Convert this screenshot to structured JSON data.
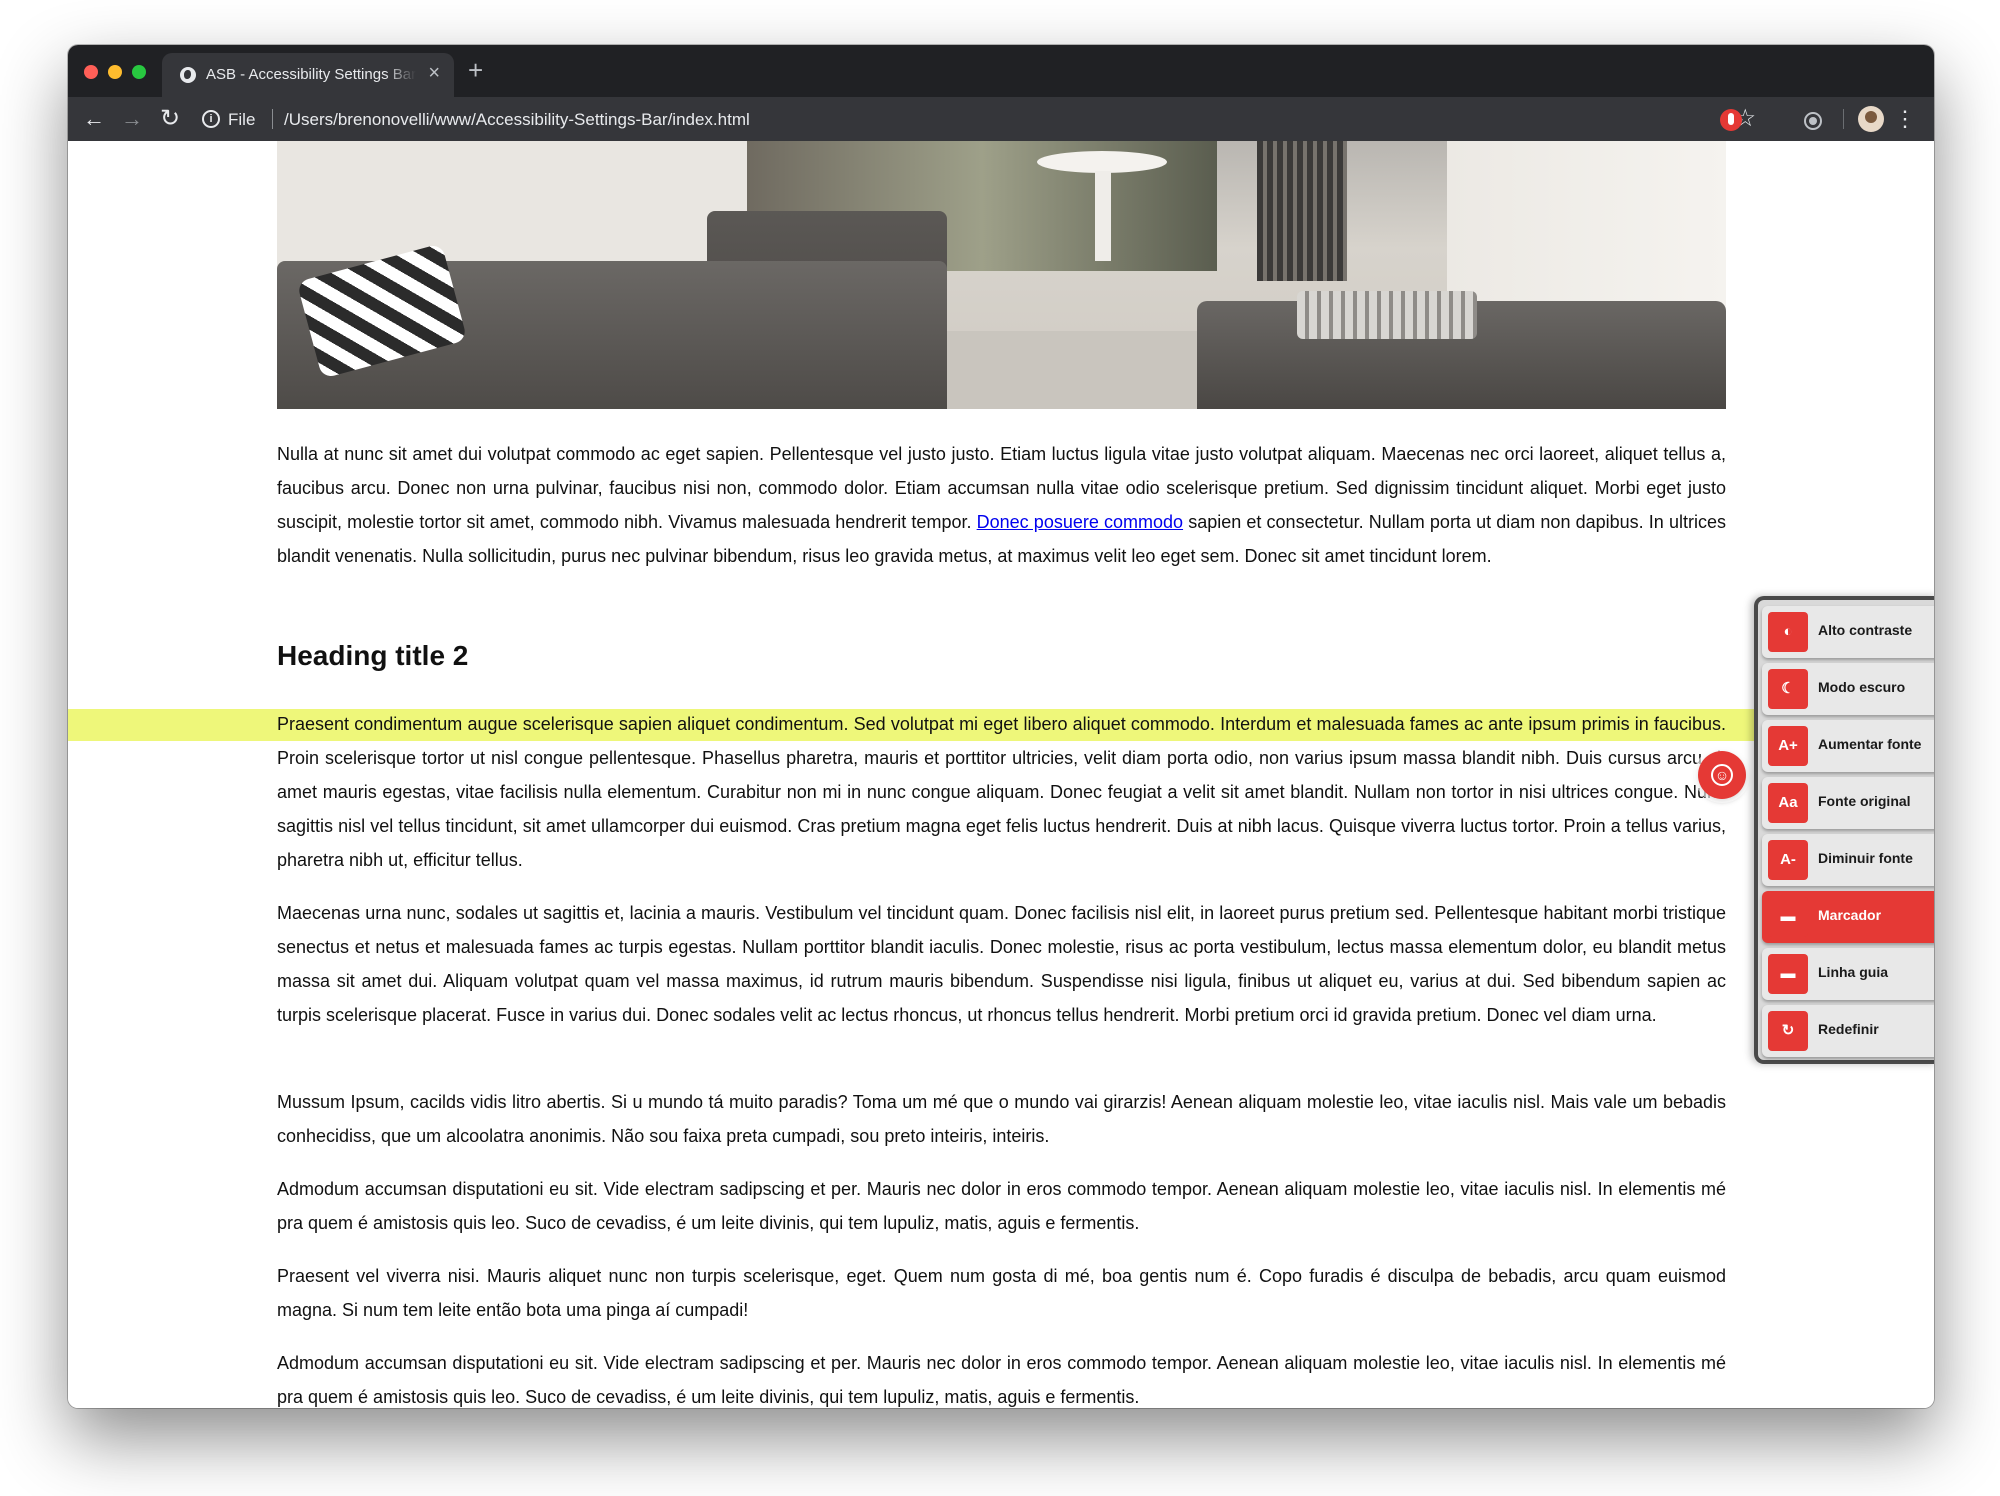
{
  "browser": {
    "tab_title": "ASB - Accessibility Settings Bar",
    "tab_close": "×",
    "new_tab": "+",
    "back_glyph": "←",
    "forward_glyph": "→",
    "reload_glyph": "↻",
    "info_glyph": "i",
    "file_label": "File",
    "url": "/Users/brenonovelli/www/Accessibility-Settings-Bar/index.html",
    "star_glyph": "☆",
    "menu_glyph": "⋮"
  },
  "article": {
    "p1_part1": "Nulla at nunc sit amet dui volutpat commodo ac eget sapien. Pellentesque vel justo justo. Etiam luctus ligula vitae justo volutpat aliquam. Maecenas nec orci laoreet, aliquet tellus a, faucibus arcu. Donec non urna pulvinar, faucibus nisi non, commodo dolor. Etiam accumsan nulla vitae odio scelerisque pretium. Sed dignissim tincidunt aliquet. Morbi eget justo suscipit, molestie tortor sit amet, commodo nibh. Vivamus malesuada hendrerit tempor. ",
    "p1_link": "Donec posuere commodo",
    "p1_part2": " sapien et consectetur. Nullam porta ut diam non dapibus. In ultrices blandit venenatis. Nulla sollicitudin, purus nec pulvinar bibendum, risus leo gravida metus, at maximus velit leo eget sem. Donec sit amet tincidunt lorem.",
    "heading": "Heading title 2",
    "p2": "Praesent condimentum augue scelerisque sapien aliquet condimentum. Sed volutpat mi eget libero aliquet commodo. Interdum et malesuada fames ac ante ipsum primis in faucibus. Proin scelerisque tortor ut nisl congue pellentesque. Phasellus pharetra, mauris et porttitor ultricies, velit diam porta odio, non varius ipsum massa blandit nibh. Duis cursus arcu sit amet mauris egestas, vitae facilisis nulla elementum. Curabitur non mi in nunc congue aliquam. Donec feugiat a velit sit amet blandit. Nullam non tortor in nisi ultrices congue. Nunc sagittis nisl vel tellus tincidunt, sit amet ullamcorper dui euismod. Cras pretium magna eget felis luctus hendrerit. Duis at nibh lacus. Quisque viverra luctus tortor. Proin a tellus varius, pharetra nibh ut, efficitur tellus.",
    "p3": "Maecenas urna nunc, sodales ut sagittis et, lacinia a mauris. Vestibulum vel tincidunt quam. Donec facilisis nisl elit, in laoreet purus pretium sed. Pellentesque habitant morbi tristique senectus et netus et malesuada fames ac turpis egestas. Nullam porttitor blandit iaculis. Donec molestie, risus ac porta vestibulum, lectus massa elementum dolor, eu blandit metus massa sit amet dui. Aliquam volutpat quam vel massa maximus, id rutrum mauris bibendum. Suspendisse nisi ligula, finibus ut aliquet eu, varius at dui. Sed bibendum sapien ac turpis scelerisque placerat. Fusce in varius dui. Donec sodales velit ac lectus rhoncus, ut rhoncus tellus hendrerit. Morbi pretium orci id gravida pretium. Donec vel diam urna.",
    "p4": "Mussum Ipsum, cacilds vidis litro abertis. Si u mundo tá muito paradis? Toma um mé que o mundo vai girarzis! Aenean aliquam molestie leo, vitae iaculis nisl. Mais vale um bebadis conhecidiss, que um alcoolatra anonimis. Não sou faixa preta cumpadi, sou preto inteiris, inteiris.",
    "p5": "Admodum accumsan disputationi eu sit. Vide electram sadipscing et per. Mauris nec dolor in eros commodo tempor. Aenean aliquam molestie leo, vitae iaculis nisl. In elementis mé pra quem é amistosis quis leo. Suco de cevadiss, é um leite divinis, qui tem lupuliz, matis, aguis e fermentis.",
    "p6": "Praesent vel viverra nisi. Mauris aliquet nunc non turpis scelerisque, eget. Quem num gosta di mé, boa gentis num é. Copo furadis é disculpa de bebadis, arcu quam euismod magna. Si num tem leite então bota uma pinga aí cumpadi!",
    "p7": "Admodum accumsan disputationi eu sit. Vide electram sadipscing et per. Mauris nec dolor in eros commodo tempor. Aenean aliquam molestie leo, vitae iaculis nisl. In elementis mé pra quem é amistosis quis leo. Suco de cevadiss, é um leite divinis, qui tem lupuliz, matis, aguis e fermentis."
  },
  "asb": {
    "toggle_glyph": "☺",
    "items": [
      {
        "label": "Alto contraste",
        "icon": "◐",
        "icon_name": "contrast-icon",
        "active": false
      },
      {
        "label": "Modo escuro",
        "icon": "☾",
        "icon_name": "moon-icon",
        "active": false
      },
      {
        "label": "Aumentar fonte",
        "icon": "A+",
        "icon_name": "font-increase-icon",
        "active": false
      },
      {
        "label": "Fonte original",
        "icon": "Aa",
        "icon_name": "font-original-icon",
        "active": false
      },
      {
        "label": "Diminuir fonte",
        "icon": "A-",
        "icon_name": "font-decrease-icon",
        "active": false
      },
      {
        "label": "Marcador",
        "icon": "▬",
        "icon_name": "marker-icon",
        "active": true
      },
      {
        "label": "Linha guia",
        "icon": "▬",
        "icon_name": "guide-line-icon",
        "active": false
      },
      {
        "label": "Redefinir",
        "icon": "↻",
        "icon_name": "reset-icon",
        "active": false
      }
    ]
  },
  "colors": {
    "accent": "#e53935",
    "highlight": "#eef77a",
    "link": "#0000ee",
    "browser_dark": "#202124"
  }
}
